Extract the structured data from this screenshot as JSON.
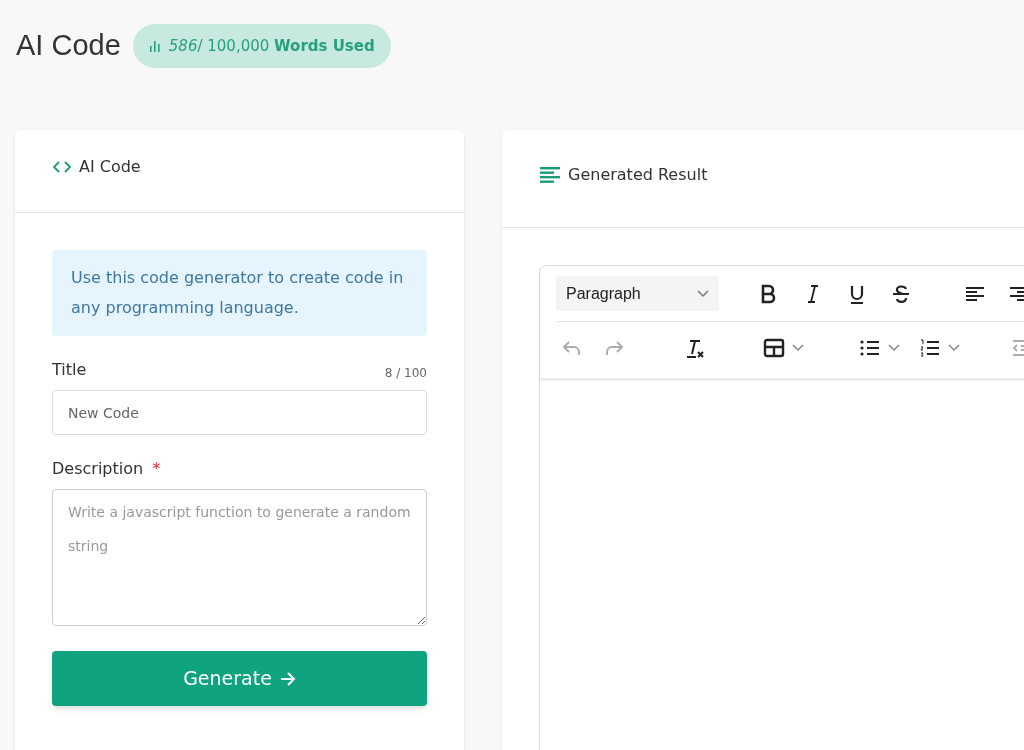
{
  "page_title": "AI Code",
  "usage": {
    "used": "586",
    "limit": "/ 100,000",
    "label": "Words Used"
  },
  "form_card": {
    "title": "AI Code",
    "info": "Use this code generator to create code in any programming language.",
    "fields": [
      {
        "kind": "input",
        "label": "Title",
        "counter": "8 / 100",
        "value": "New Code",
        "required": false
      },
      {
        "kind": "textarea",
        "label": "Description",
        "required": true,
        "required_mark": "*",
        "placeholder": "Write a javascript function to generate a random string"
      }
    ],
    "button": "Generate"
  },
  "result_card": {
    "title": "Generated Result",
    "editor": {
      "block_select": "Paragraph",
      "row_1": [
        {
          "kind": "bold",
          "disabled": false
        },
        {
          "kind": "italic",
          "disabled": false
        },
        {
          "kind": "underline",
          "disabled": false
        },
        {
          "kind": "strike",
          "disabled": false
        },
        {
          "kind": "align-left",
          "disabled": false
        },
        {
          "kind": "align-right",
          "disabled": false
        }
      ],
      "row_2": [
        {
          "kind": "undo",
          "disabled": true
        },
        {
          "kind": "redo",
          "disabled": true
        },
        {
          "kind": "clear-format",
          "disabled": false
        },
        {
          "kind": "table",
          "disabled": false
        },
        {
          "kind": "bullet-list",
          "disabled": false
        },
        {
          "kind": "numbered-list",
          "disabled": false
        },
        {
          "kind": "outdent",
          "disabled": true
        }
      ]
    }
  }
}
